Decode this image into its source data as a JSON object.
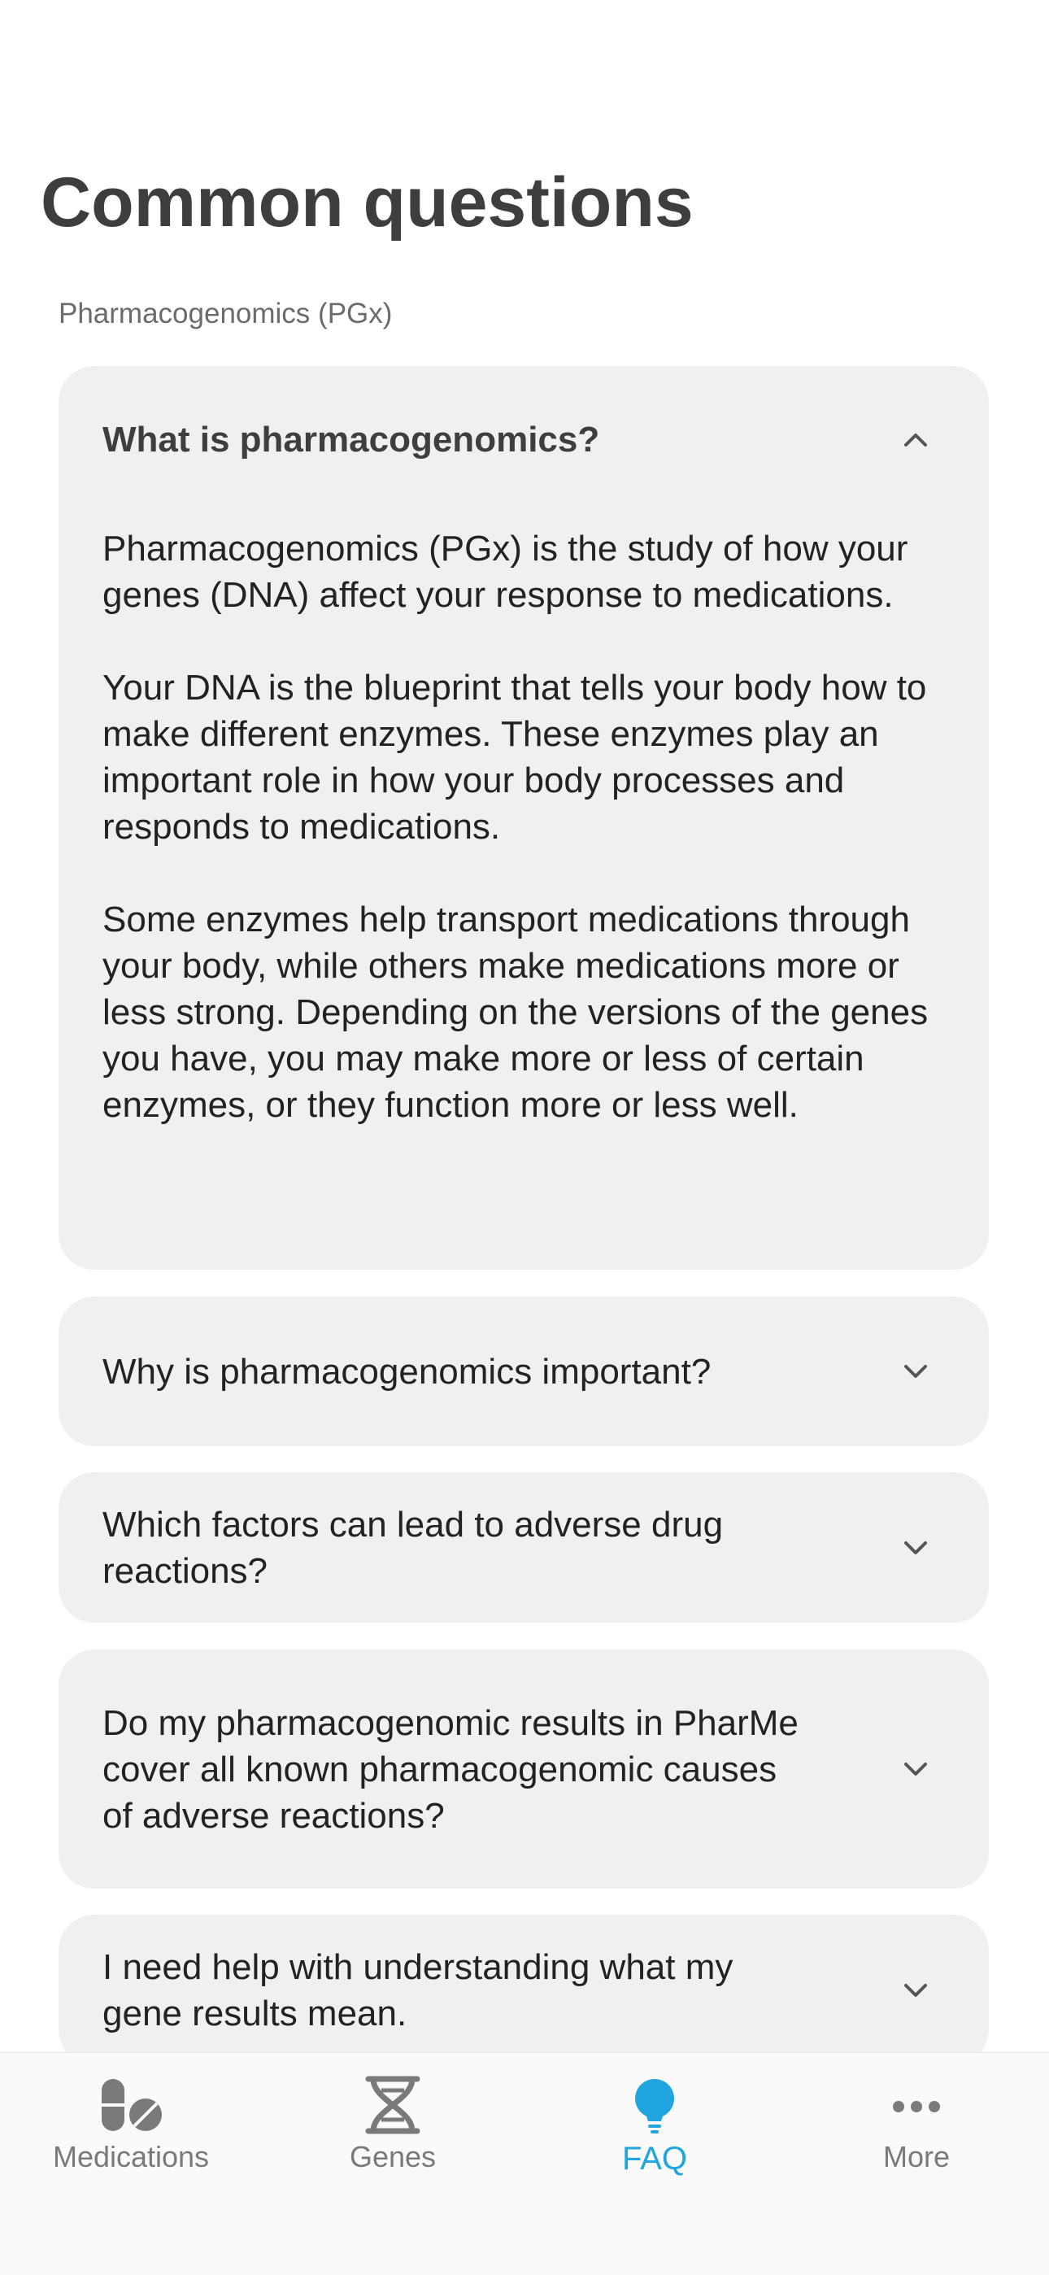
{
  "header": {
    "title": "Common questions"
  },
  "section": {
    "label": "Pharmacogenomics (PGx)"
  },
  "faq": [
    {
      "question": "What is pharmacogenomics?",
      "expanded": true,
      "answer": [
        "Pharmacogenomics (PGx) is the study of how your genes (DNA) affect your response to medications.",
        "Your DNA is the blueprint that tells your body how to make different enzymes. These enzymes play an important role in how your body processes and responds to medications.",
        "Some enzymes help transport medications through your body, while others make medications more or less strong. Depending on the versions of the genes you have, you may make more or less of certain enzymes, or they function more or less well."
      ]
    },
    {
      "question": "Why is pharmacogenomics important?",
      "expanded": false
    },
    {
      "question": "Which factors can lead to adverse drug reactions?",
      "expanded": false
    },
    {
      "question": "Do my pharmacogenomic results in PharMe cover all known pharmacogenomic causes of adverse reactions?",
      "expanded": false
    },
    {
      "question": "I need help with understanding what my gene results mean.",
      "expanded": false
    }
  ],
  "tab_bar": {
    "tabs": [
      {
        "label": "Medications",
        "icon": "pill-icon",
        "active": false
      },
      {
        "label": "Genes",
        "icon": "dna-icon",
        "active": false
      },
      {
        "label": "FAQ",
        "icon": "lightbulb-icon",
        "active": true
      },
      {
        "label": "More",
        "icon": "more-icon",
        "active": false
      }
    ]
  },
  "colors": {
    "accent": "#1fa6e0",
    "card_background": "#f0f0f0",
    "title_text": "#3e3e3e",
    "inactive_tab": "#7a7a7a"
  }
}
